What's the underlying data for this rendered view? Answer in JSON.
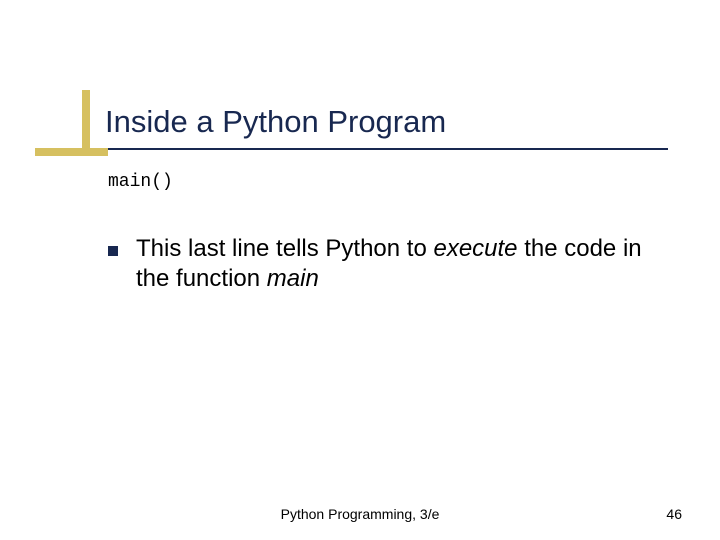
{
  "title": "Inside a Python Program",
  "code": "main()",
  "body": {
    "parts": [
      "This last line tells Python to ",
      "execute",
      " the code in the function ",
      "main"
    ]
  },
  "footer": {
    "center": "Python Programming, 3/e",
    "page": "46"
  }
}
